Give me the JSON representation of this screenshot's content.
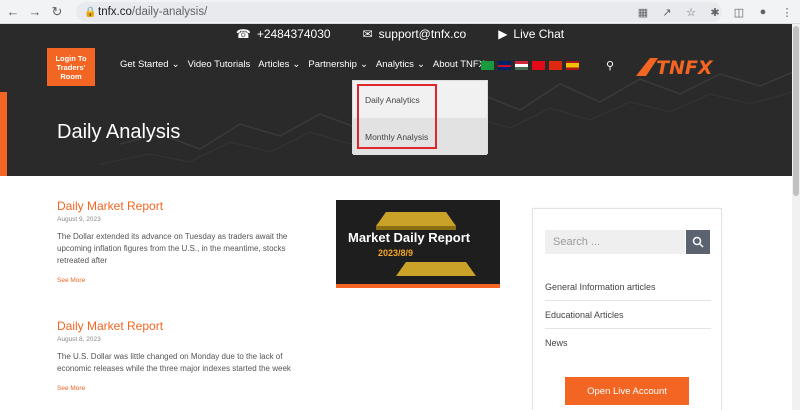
{
  "browser": {
    "url_host": "tnfx.co",
    "url_path": "/daily-analysis/"
  },
  "topbar": {
    "phone": "+2484374030",
    "email": "support@tnfx.co",
    "chat": "Live Chat"
  },
  "header": {
    "login_lines": [
      "Login To",
      "Traders'",
      "Room"
    ],
    "nav": [
      "Get Started",
      "Video Tutorials",
      "Articles",
      "Partnership",
      "Analytics",
      "About TNFX"
    ],
    "brand": "TNFX",
    "hero_title": "Daily Analysis"
  },
  "dropdown": {
    "items": [
      "Daily Analytics",
      "Monthly Analysis"
    ]
  },
  "articles": [
    {
      "title": "Daily Market Report",
      "date": "August 9, 2023",
      "body": "The Dollar extended its advance on Tuesday as traders await the upcoming inflation figures from the U.S., in the meantime, stocks retreated after",
      "more": "See More"
    },
    {
      "title": "Daily Market Report",
      "date": "August 8, 2023",
      "body": "The U.S. Dollar was little changed on Monday due to the lack of economic releases while the three major indexes started the week",
      "more": "See More"
    }
  ],
  "thumbnail": {
    "line1": "Market Daily Report",
    "line2": "2023/8/9"
  },
  "sidebar": {
    "search_placeholder": "Search ...",
    "links": [
      "General Information articles",
      "Educational Articles",
      "News"
    ],
    "cta": "Open Live Account"
  },
  "colors": {
    "accent": "#f26522",
    "header_bg": "#2a2a2a"
  }
}
